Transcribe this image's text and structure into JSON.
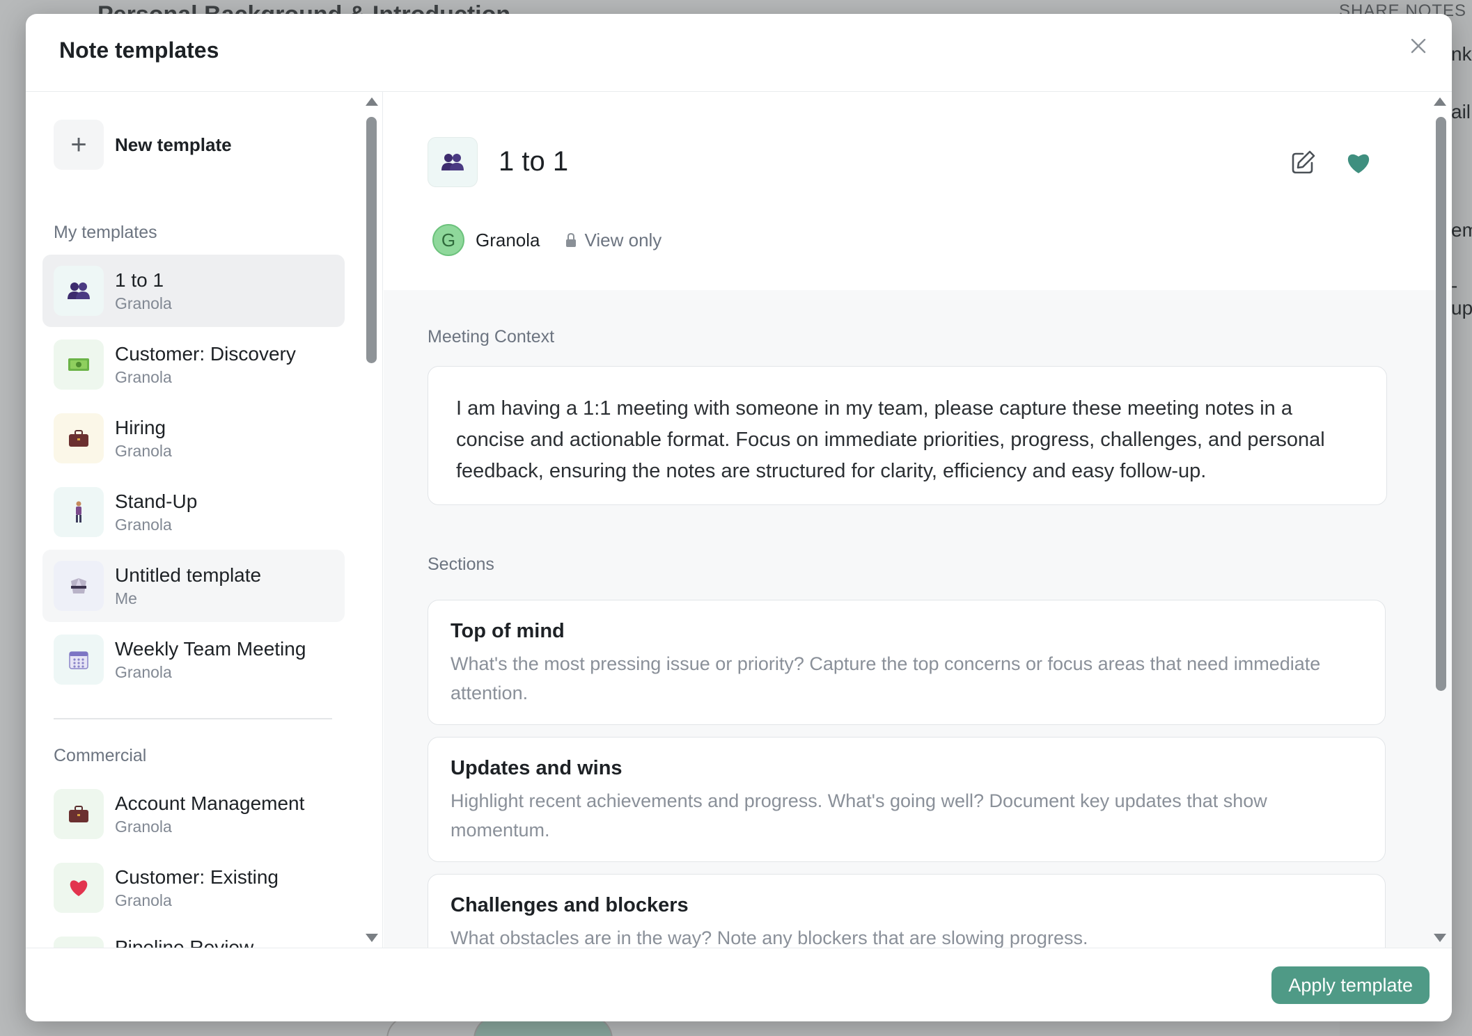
{
  "background": {
    "doc_title": "Personal Background & Introduction",
    "share_label": "SHARE NOTES",
    "right_fragments": [
      "nk",
      "ail",
      "em",
      "-up"
    ]
  },
  "modal": {
    "title": "Note templates",
    "close_icon": "close-icon"
  },
  "sidebar": {
    "new_template_label": "New template",
    "my_templates_label": "My templates",
    "my_templates": [
      {
        "name": "1 to 1",
        "owner": "Granola",
        "icon": "two-people-icon",
        "icon_bg": "#eef7f6",
        "active": true
      },
      {
        "name": "Customer: Discovery",
        "owner": "Granola",
        "icon": "money-icon",
        "icon_bg": "#eef7ee"
      },
      {
        "name": "Hiring",
        "owner": "Granola",
        "icon": "briefcase-icon",
        "icon_bg": "#fbf7e8"
      },
      {
        "name": "Stand-Up",
        "owner": "Granola",
        "icon": "person-standing-icon",
        "icon_bg": "#eef7f6"
      },
      {
        "name": "Untitled template",
        "owner": "Me",
        "icon": "martial-arts-icon",
        "icon_bg": "#eef0f8"
      },
      {
        "name": "Weekly Team Meeting",
        "owner": "Granola",
        "icon": "calendar-icon",
        "icon_bg": "#eef7f6"
      }
    ],
    "commercial_label": "Commercial",
    "commercial": [
      {
        "name": "Account Management",
        "owner": "Granola",
        "icon": "briefcase-icon",
        "icon_bg": "#eef7ee"
      },
      {
        "name": "Customer: Existing",
        "owner": "Granola",
        "icon": "heart-icon",
        "icon_bg": "#eef7ee"
      },
      {
        "name": "Pipeline Review",
        "owner": "",
        "icon": "pencil-icon",
        "icon_bg": "#eef7ee"
      }
    ]
  },
  "main": {
    "title": "1 to 1",
    "owner_initial": "G",
    "owner_name": "Granola",
    "permission": "View only",
    "meeting_context_label": "Meeting Context",
    "meeting_context": "I am having a 1:1 meeting with someone in my team, please capture these meeting notes in a concise and actionable format. Focus on immediate priorities, progress, challenges, and personal feedback, ensuring the notes are structured for clarity, efficiency and easy follow-up.",
    "sections_label": "Sections",
    "sections": [
      {
        "title": "Top of mind",
        "description": "What's the most pressing issue or priority? Capture the top concerns or focus areas that need immediate attention."
      },
      {
        "title": "Updates and wins",
        "description": "Highlight recent achievements and progress. What's going well? Document key updates that show momentum."
      },
      {
        "title": "Challenges and blockers",
        "description": "What obstacles are in the way? Note any blockers that are slowing progress."
      }
    ]
  },
  "footer": {
    "apply_label": "Apply template"
  },
  "colors": {
    "accent": "#4f9a86",
    "heart": "#3f8f7f",
    "avatar_bg": "#8fd89b"
  }
}
